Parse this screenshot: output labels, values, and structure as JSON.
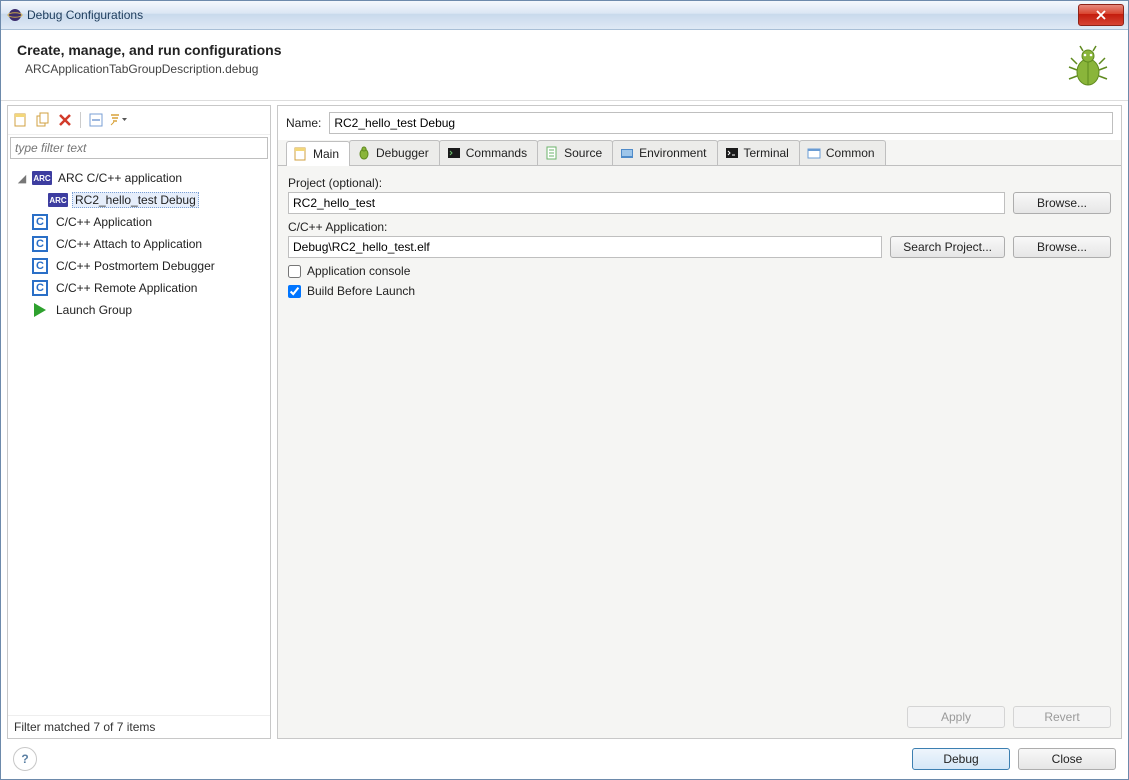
{
  "window": {
    "title": "Debug Configurations"
  },
  "header": {
    "title": "Create, manage, and run configurations",
    "subtitle": "ARCApplicationTabGroupDescription.debug"
  },
  "filter": {
    "placeholder": "type filter text",
    "status": "Filter matched 7 of 7 items"
  },
  "tree": {
    "items": [
      {
        "label": "ARC C/C++ application",
        "kind": "arc",
        "children": [
          {
            "label": "RC2_hello_test Debug",
            "kind": "arc",
            "selected": true
          }
        ]
      },
      {
        "label": "C/C++ Application",
        "kind": "c"
      },
      {
        "label": "C/C++ Attach to Application",
        "kind": "c"
      },
      {
        "label": "C/C++ Postmortem Debugger",
        "kind": "c"
      },
      {
        "label": "C/C++ Remote Application",
        "kind": "c"
      },
      {
        "label": "Launch Group",
        "kind": "play"
      }
    ]
  },
  "config": {
    "name_label": "Name:",
    "name_value": "RC2_hello_test Debug",
    "tabs": [
      "Main",
      "Debugger",
      "Commands",
      "Source",
      "Environment",
      "Terminal",
      "Common"
    ],
    "main": {
      "project_label": "Project (optional):",
      "project_value": "RC2_hello_test",
      "app_label": "C/C++ Application:",
      "app_value": "Debug\\RC2_hello_test.elf",
      "checkbox_console": "Application console",
      "checkbox_build": "Build Before Launch"
    },
    "buttons": {
      "browse": "Browse...",
      "search_project": "Search Project...",
      "apply": "Apply",
      "revert": "Revert",
      "debug": "Debug",
      "close": "Close"
    }
  }
}
